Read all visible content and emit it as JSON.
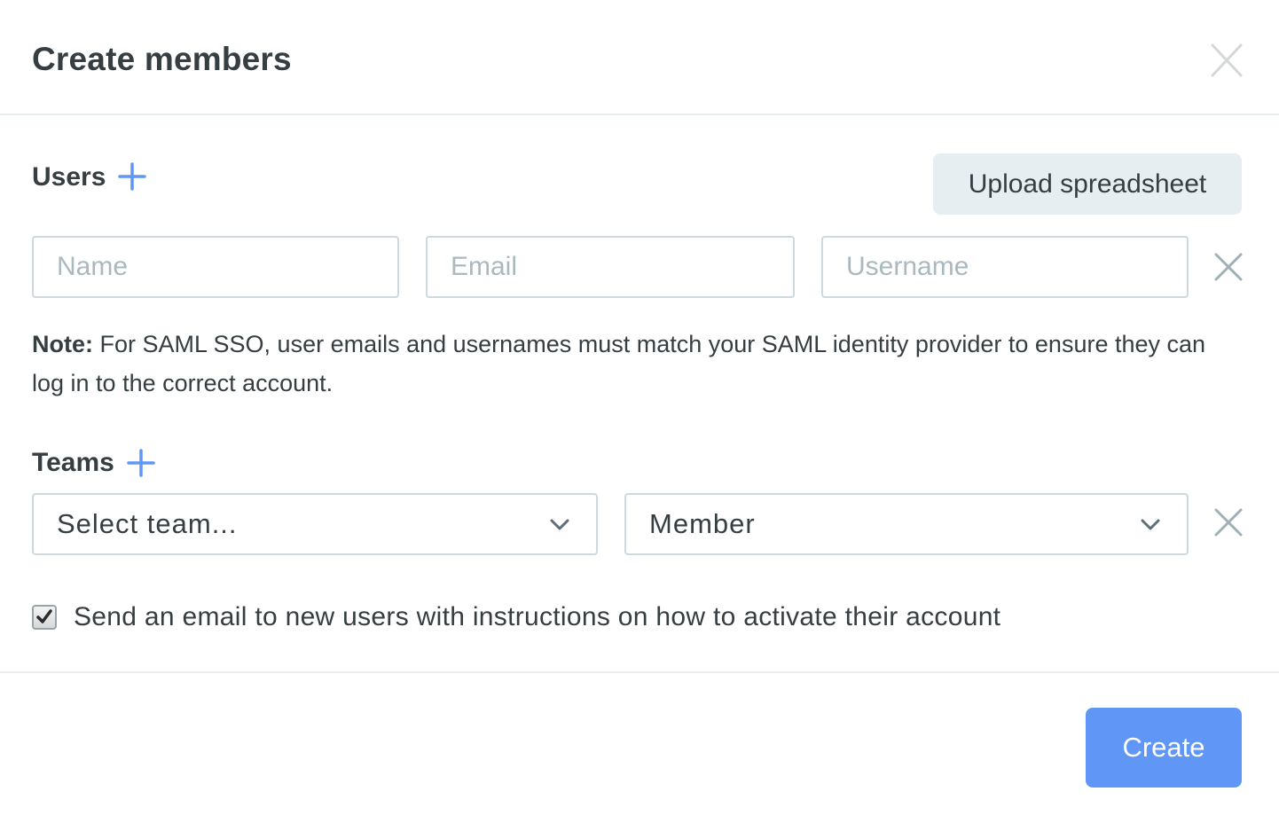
{
  "dialog": {
    "title": "Create members",
    "close_icon": "close-icon"
  },
  "users": {
    "label": "Users",
    "add_icon": "plus-icon",
    "upload_button": "Upload spreadsheet",
    "rows": [
      {
        "name": {
          "value": "",
          "placeholder": "Name"
        },
        "email": {
          "value": "",
          "placeholder": "Email"
        },
        "username": {
          "value": "",
          "placeholder": "Username"
        },
        "remove_icon": "close-icon"
      }
    ]
  },
  "note": {
    "label": "Note:",
    "text": " For SAML SSO, user emails and usernames must match your SAML identity provider to ensure they can log in to the correct account."
  },
  "teams": {
    "label": "Teams",
    "add_icon": "plus-icon",
    "rows": [
      {
        "team": {
          "selected": "Select team..."
        },
        "role": {
          "selected": "Member"
        },
        "remove_icon": "close-icon"
      }
    ]
  },
  "send_email": {
    "checked": true,
    "label": "Send an email to new users with instructions on how to activate their account"
  },
  "footer": {
    "create_button": "Create"
  },
  "colors": {
    "accent": "#6096f5",
    "text": "#363e42",
    "placeholder": "#a9b9bf",
    "border": "#cfd9dd",
    "secondary_button_bg": "#e7eef1"
  }
}
